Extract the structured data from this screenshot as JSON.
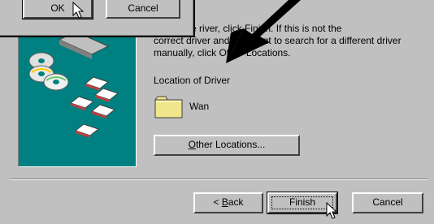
{
  "overlay_dialog": {
    "ok_label": "OK",
    "cancel_label": "Cancel"
  },
  "wizard": {
    "instruction_text_line1": "ant to use  river, click Finish. If this is not the",
    "instruction_text_line2": "correct driver and you want to search for a different driver",
    "instruction_text_line3": "manually, click Other Locations.",
    "location_title": "Location of Driver",
    "folder_name": "Wan",
    "other_locations_label_u": "O",
    "other_locations_label_rest": "ther Locations...",
    "back_prefix": "< ",
    "back_label_u": "B",
    "back_label_rest": "ack",
    "finish_label": "Finish",
    "cancel_label": "Cancel"
  },
  "icons": {
    "folder": "folder-icon",
    "cursor": "mouse-pointer-icon",
    "arrow": "annotation-arrow-icon",
    "wizard_picture": "cd-and-disks-illustration"
  },
  "colors": {
    "face": "#c0c0c0",
    "picture_bg": "#008080",
    "folder_fill": "#f0e68c"
  }
}
